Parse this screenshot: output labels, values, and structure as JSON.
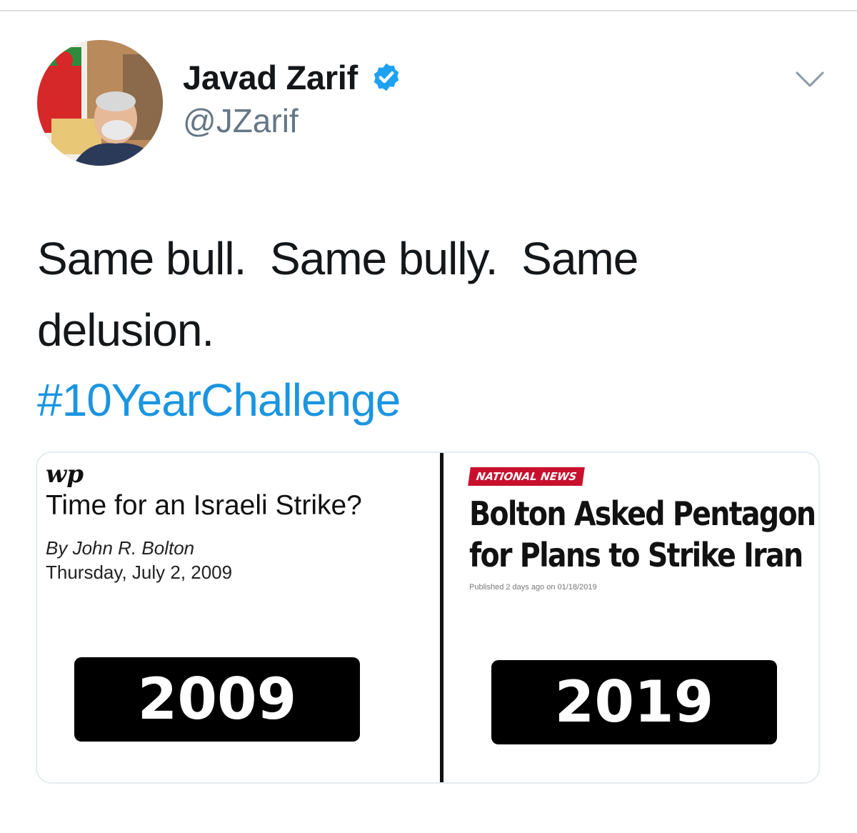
{
  "tweet": {
    "author": {
      "display_name": "Javad Zarif",
      "handle": "@JZarif",
      "verified": true
    },
    "text_line1": "Same bull.  Same bully.  Same",
    "text_line2": "delusion.",
    "hashtag": "#10YearChallenge",
    "icons": {
      "verified": "verified-badge-icon",
      "menu": "chevron-down-icon"
    },
    "colors": {
      "link": "#1b95e0",
      "verified": "#1da1f2",
      "handle": "#657786"
    }
  },
  "media": {
    "left": {
      "logo": "wp",
      "headline": "Time for an Israeli Strike?",
      "byline": "By John R. Bolton",
      "date": "Thursday, July 2, 2009",
      "year_label": "2009"
    },
    "right": {
      "section_badge": "NATIONAL NEWS",
      "headline_line1": "Bolton Asked Pentagon",
      "headline_line2": "for Plans to Strike Iran",
      "published": "Published 2 days ago on 01/18/2019",
      "year_label": "2019"
    }
  }
}
